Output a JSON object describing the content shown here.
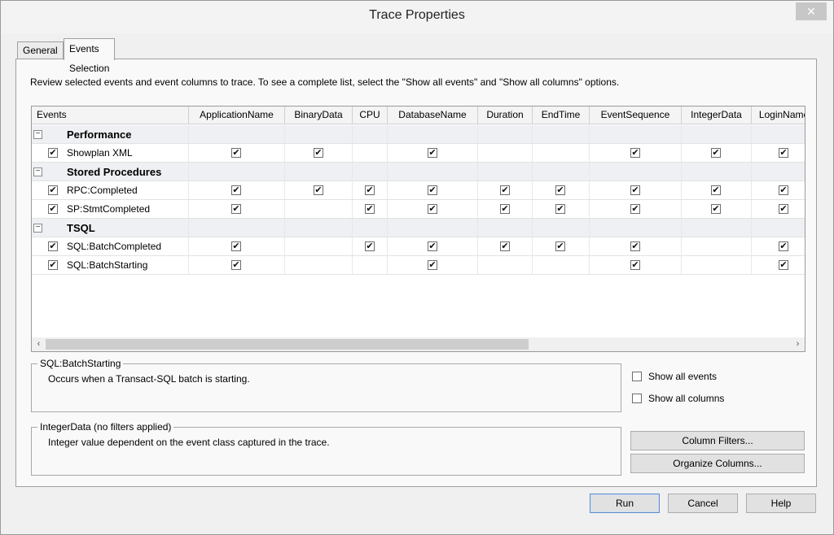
{
  "window": {
    "title": "Trace Properties",
    "close_glyph": "✕"
  },
  "tabs": [
    {
      "label": "General",
      "active": false
    },
    {
      "label": "Events Selection",
      "active": true
    }
  ],
  "instructions": "Review selected events and event columns to trace. To see a complete list, select the \"Show all events\" and \"Show all columns\" options.",
  "grid": {
    "first_column": "Events",
    "columns": [
      "ApplicationName",
      "BinaryData",
      "CPU",
      "DatabaseName",
      "Duration",
      "EndTime",
      "EventSequence",
      "IntegerData",
      "LoginName"
    ],
    "groups": [
      {
        "name": "Performance",
        "events": [
          {
            "name": "Showplan XML",
            "checked": true,
            "cols": [
              true,
              true,
              false,
              true,
              false,
              false,
              true,
              true,
              true
            ]
          }
        ]
      },
      {
        "name": "Stored Procedures",
        "events": [
          {
            "name": "RPC:Completed",
            "checked": true,
            "cols": [
              true,
              true,
              true,
              true,
              true,
              true,
              true,
              true,
              true
            ]
          },
          {
            "name": "SP:StmtCompleted",
            "checked": true,
            "cols": [
              true,
              false,
              true,
              true,
              true,
              true,
              true,
              true,
              true
            ]
          }
        ]
      },
      {
        "name": "TSQL",
        "events": [
          {
            "name": "SQL:BatchCompleted",
            "checked": true,
            "cols": [
              true,
              false,
              true,
              true,
              true,
              true,
              true,
              false,
              true
            ]
          },
          {
            "name": "SQL:BatchStarting",
            "checked": true,
            "cols": [
              true,
              false,
              false,
              true,
              false,
              false,
              true,
              false,
              true
            ]
          }
        ]
      }
    ],
    "expander_glyph": "−",
    "check_glyph": "✔",
    "scroll_left": "‹",
    "scroll_right": "›"
  },
  "event_info": {
    "title": "SQL:BatchStarting",
    "description": "Occurs when a Transact-SQL batch is starting."
  },
  "column_info": {
    "title": "IntegerData (no filters applied)",
    "description": "Integer value dependent on the event class captured in the trace."
  },
  "options": {
    "show_all_events": {
      "label": "Show all events",
      "checked": false
    },
    "show_all_columns": {
      "label": "Show all columns",
      "checked": false
    }
  },
  "buttons": {
    "column_filters": "Column Filters...",
    "organize_columns": "Organize Columns...",
    "run": "Run",
    "cancel": "Cancel",
    "help": "Help"
  }
}
